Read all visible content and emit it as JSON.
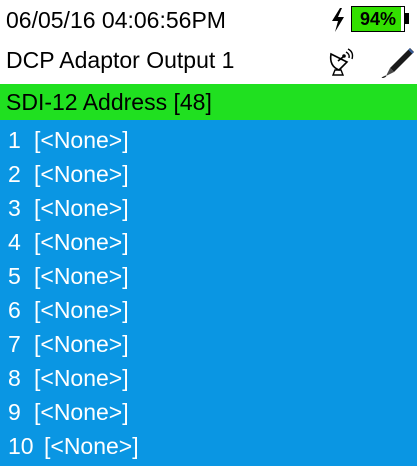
{
  "status": {
    "datetime": "06/05/16 04:06:56PM",
    "battery_percent": "94%",
    "battery_level": 0.94,
    "icons": [
      "lightning-bolt-icon",
      "battery-icon"
    ]
  },
  "header": {
    "title": "DCP Adaptor Output 1",
    "icons": [
      "satellite-dish-icon",
      "probe-pen-icon"
    ]
  },
  "selected": {
    "label": "SDI-12 Address [48]",
    "highlight_color": "#20e020"
  },
  "list": {
    "background_color": "#0a96e3",
    "items": [
      {
        "number": "1",
        "value": "[<None>]"
      },
      {
        "number": "2",
        "value": "[<None>]"
      },
      {
        "number": "3",
        "value": "[<None>]"
      },
      {
        "number": "4",
        "value": "[<None>]"
      },
      {
        "number": "5",
        "value": "[<None>]"
      },
      {
        "number": "6",
        "value": "[<None>]"
      },
      {
        "number": "7",
        "value": "[<None>]"
      },
      {
        "number": "8",
        "value": "[<None>]"
      },
      {
        "number": "9",
        "value": "[<None>]"
      },
      {
        "number": "10",
        "value": "[<None>]"
      }
    ]
  }
}
